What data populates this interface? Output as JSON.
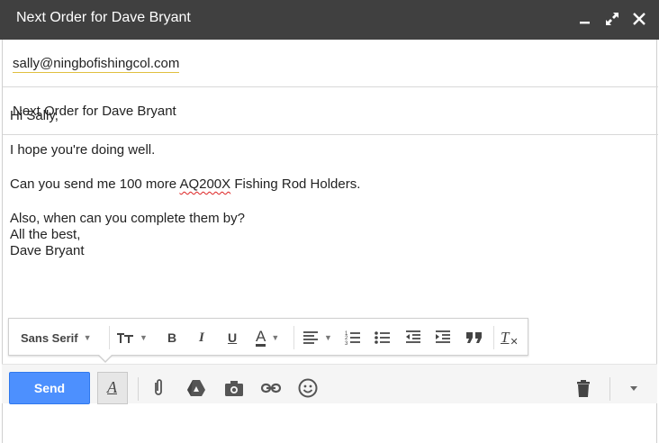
{
  "window": {
    "title": "Next Order for Dave Bryant",
    "controls": [
      "minimize-icon",
      "expand-icon",
      "close-icon"
    ]
  },
  "compose": {
    "to": "sally@ningbofishingcol.com",
    "subject": "Next Order for Dave Bryant",
    "body": {
      "greeting": "Hi Sally,",
      "line1": "I hope you're doing well.",
      "line2_before": "Can you send me 100 more ",
      "line2_misspelled": "AQ200X",
      "line2_after": " Fishing Rod Holders.",
      "line3": "Also, when can you complete them by?",
      "signoff": "All the best,",
      "signature": "Dave Bryant"
    }
  },
  "format_toolbar": {
    "font_family": "Sans Serif",
    "items": [
      "text-size-icon",
      "bold-icon",
      "italic-icon",
      "underline-icon",
      "text-color-icon",
      "align-icon",
      "numbered-list-icon",
      "bulleted-list-icon",
      "indent-less-icon",
      "indent-more-icon",
      "quote-icon",
      "remove-formatting-icon"
    ],
    "bold_glyph": "B",
    "italic_glyph": "I",
    "underline_glyph": "U",
    "color_glyph": "A",
    "clear_glyph": "T"
  },
  "bottom_bar": {
    "send_label": "Send",
    "format_toggle_glyph": "A",
    "icons": [
      "attach-icon",
      "drive-icon",
      "photo-icon",
      "link-icon",
      "emoji-icon",
      "trash-icon",
      "more-options-icon"
    ]
  },
  "colors": {
    "titlebar": "#404040",
    "send": "#4d90fe",
    "spellcheck": "#dd2222"
  }
}
